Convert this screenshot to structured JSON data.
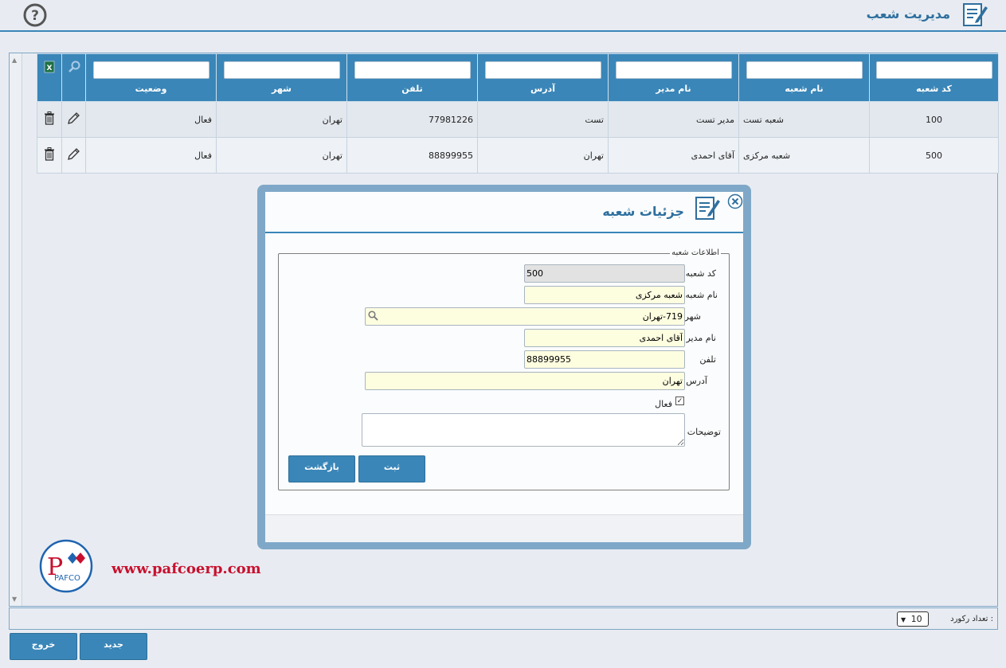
{
  "header": {
    "title": "مدیریت شعب"
  },
  "grid": {
    "columns": [
      "کد شعبه",
      "نام شعبه",
      "نام مدیر",
      "آدرس",
      "تلفن",
      "شهر",
      "وضعیت"
    ],
    "rows": [
      {
        "code": "100",
        "name": "شعبه تست",
        "manager": "مدیر تست",
        "address": "تست",
        "phone": "77981226",
        "city": "تهران",
        "status": "فعال"
      },
      {
        "code": "500",
        "name": "شعبه مرکزی",
        "manager": "آقای احمدی",
        "address": "تهران",
        "phone": "88899955",
        "city": "تهران",
        "status": "فعال"
      }
    ]
  },
  "modal": {
    "title": "جزئیات شعبه",
    "fieldset_legend": "اطلاعات شعبه",
    "fields": {
      "code_label": "کد شعبه",
      "code_value": "500",
      "name_label": "نام شعبه",
      "name_value": "شعبه مرکزی",
      "city_label": "شهر",
      "city_value": "719-تهران",
      "manager_label": "نام مدیر",
      "manager_value": "آقای احمدی",
      "phone_label": "تلفن",
      "phone_value": "88899955",
      "address_label": "آدرس",
      "address_value": "تهران",
      "active_label": "فعال",
      "notes_label": "توضیحات",
      "notes_value": ""
    },
    "buttons": {
      "submit": "ثبت",
      "back": "بازگشت"
    }
  },
  "branding": {
    "website": "www.pafcoerp.com",
    "logo_text": "PAFCO"
  },
  "footer": {
    "record_count_label": "تعداد رکورد :",
    "record_count_value": "10",
    "new_button": "جدید",
    "exit_button": "خروج"
  }
}
